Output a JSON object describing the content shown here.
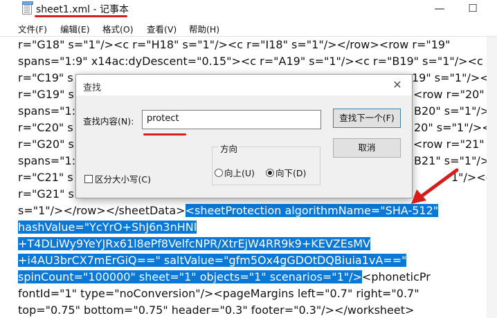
{
  "window": {
    "title": "sheet1.xml - 记事本",
    "minimize_glyph": "—",
    "maximize_glyph": "☐"
  },
  "menu": [
    {
      "label": "文件(F)"
    },
    {
      "label": "编辑(E)"
    },
    {
      "label": "格式(O)"
    },
    {
      "label": "查看(V)"
    },
    {
      "label": "帮助(H)"
    }
  ],
  "editor": {
    "lines": [
      {
        "text": "r=\"G18\" s=\"1\"/><c r=\"H18\" s=\"1\"/><c r=\"I18\" s=\"1\"/></row><row r=\"19\""
      },
      {
        "text": "spans=\"1:9\" x14ac:dyDescent=\"0.15\"><c r=\"A19\" s=\"1\"/><c r=\"B19\" s=\"1\"/><c"
      },
      {
        "text": "r=\"C19\" s",
        "right": "19\" s=\"1\"/><c"
      },
      {
        "text": "r=\"G19\" s",
        "right": "<row r=\"20\""
      },
      {
        "text": "spans=\"1:",
        "right": "B20\" s=\"1\"/><c"
      },
      {
        "text": "r=\"C20\" s",
        "right": "20\" s=\"1\"/><c"
      },
      {
        "text": "r=\"G20\" s",
        "right": "<row r=\"21\""
      },
      {
        "text": "spans=\"1:",
        "right": "B21\" s=\"1\"/><c"
      },
      {
        "text": "r=\"C21\" s",
        "right": "1\"/><c"
      },
      {
        "text": "r=\"G21\" s"
      }
    ],
    "line11_plain": "s=\"1\"/></row></sheetData>",
    "line11_sel": "<sheetProtection algorithmName=\"SHA-512\"",
    "sel_lines": [
      "hashValue=\"YcYrO+ShJ6n3nHNl",
      "+T4DLiWy9YeYJRx61l8ePf8VelfcNPR/XtrEjW4RR9k9+KEVZEsMV",
      "+i4AU3brCX7mErGiQ==\" saltValue=\"gfm5Ox4gGDOtDQBiuia1vA==\""
    ],
    "line15_sel": "spinCount=\"100000\" sheet=\"1\" objects=\"1\" scenarios=\"1\"/>",
    "line15_plain": "<phoneticPr",
    "tail_lines": [
      "fontId=\"1\" type=\"noConversion\"/><pageMargins left=\"0.7\" right=\"0.7\"",
      "top=\"0.75\" bottom=\"0.75\" header=\"0.3\" footer=\"0.3\"/></worksheet>"
    ]
  },
  "find_dialog": {
    "title": "查找",
    "close_glyph": "✕",
    "find_label": "查找内容(N):",
    "find_value": "protect",
    "find_next_label": "查找下一个(F)",
    "cancel_label": "取消",
    "direction_label": "方向",
    "up_label": "向上(U)",
    "down_label": "向下(D)",
    "match_case_label": "区分大小写(C)",
    "direction_selected": "down"
  },
  "colors": {
    "selection": "#0a78d7",
    "annotation_red": "#d71c1c"
  }
}
